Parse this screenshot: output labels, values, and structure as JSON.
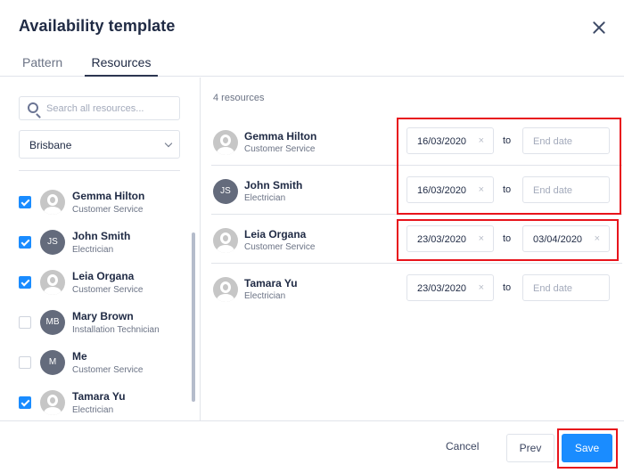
{
  "dialog": {
    "title": "Availability template",
    "close_icon": "close-icon"
  },
  "tabs": [
    {
      "label": "Pattern",
      "active": false
    },
    {
      "label": "Resources",
      "active": true
    }
  ],
  "sidebar": {
    "search": {
      "placeholder": "Search all resources...",
      "value": ""
    },
    "location": {
      "selected": "Brisbane"
    },
    "resources": [
      {
        "name": "Gemma Hilton",
        "role": "Customer Service",
        "checked": true,
        "avatar": "photo",
        "initials": ""
      },
      {
        "name": "John Smith",
        "role": "Electrician",
        "checked": true,
        "avatar": "initials",
        "initials": "JS"
      },
      {
        "name": "Leia Organa",
        "role": "Customer Service",
        "checked": true,
        "avatar": "photo",
        "initials": ""
      },
      {
        "name": "Mary Brown",
        "role": "Installation Technician",
        "checked": false,
        "avatar": "initials",
        "initials": "MB"
      },
      {
        "name": "Me",
        "role": "Customer Service",
        "checked": false,
        "avatar": "initials",
        "initials": "M"
      },
      {
        "name": "Tamara Yu",
        "role": "Electrician",
        "checked": true,
        "avatar": "photo",
        "initials": ""
      }
    ]
  },
  "main": {
    "count_label": "4 resources",
    "to_label": "to",
    "end_placeholder": "End date",
    "clear_glyph": "×",
    "rows": [
      {
        "name": "Gemma Hilton",
        "role": "Customer Service",
        "avatar": "photo",
        "initials": "",
        "start": "16/03/2020",
        "end": ""
      },
      {
        "name": "John Smith",
        "role": "Electrician",
        "avatar": "initials",
        "initials": "JS",
        "start": "16/03/2020",
        "end": ""
      },
      {
        "name": "Leia Organa",
        "role": "Customer Service",
        "avatar": "photo",
        "initials": "",
        "start": "23/03/2020",
        "end": "03/04/2020"
      },
      {
        "name": "Tamara Yu",
        "role": "Electrician",
        "avatar": "photo",
        "initials": "",
        "start": "23/03/2020",
        "end": ""
      }
    ]
  },
  "footer": {
    "cancel_label": "Cancel",
    "prev_label": "Prev",
    "save_label": "Save"
  },
  "colors": {
    "accent": "#1a8cff",
    "highlight": "#e8141c",
    "text": "#1f2a44",
    "muted": "#6b7385"
  }
}
